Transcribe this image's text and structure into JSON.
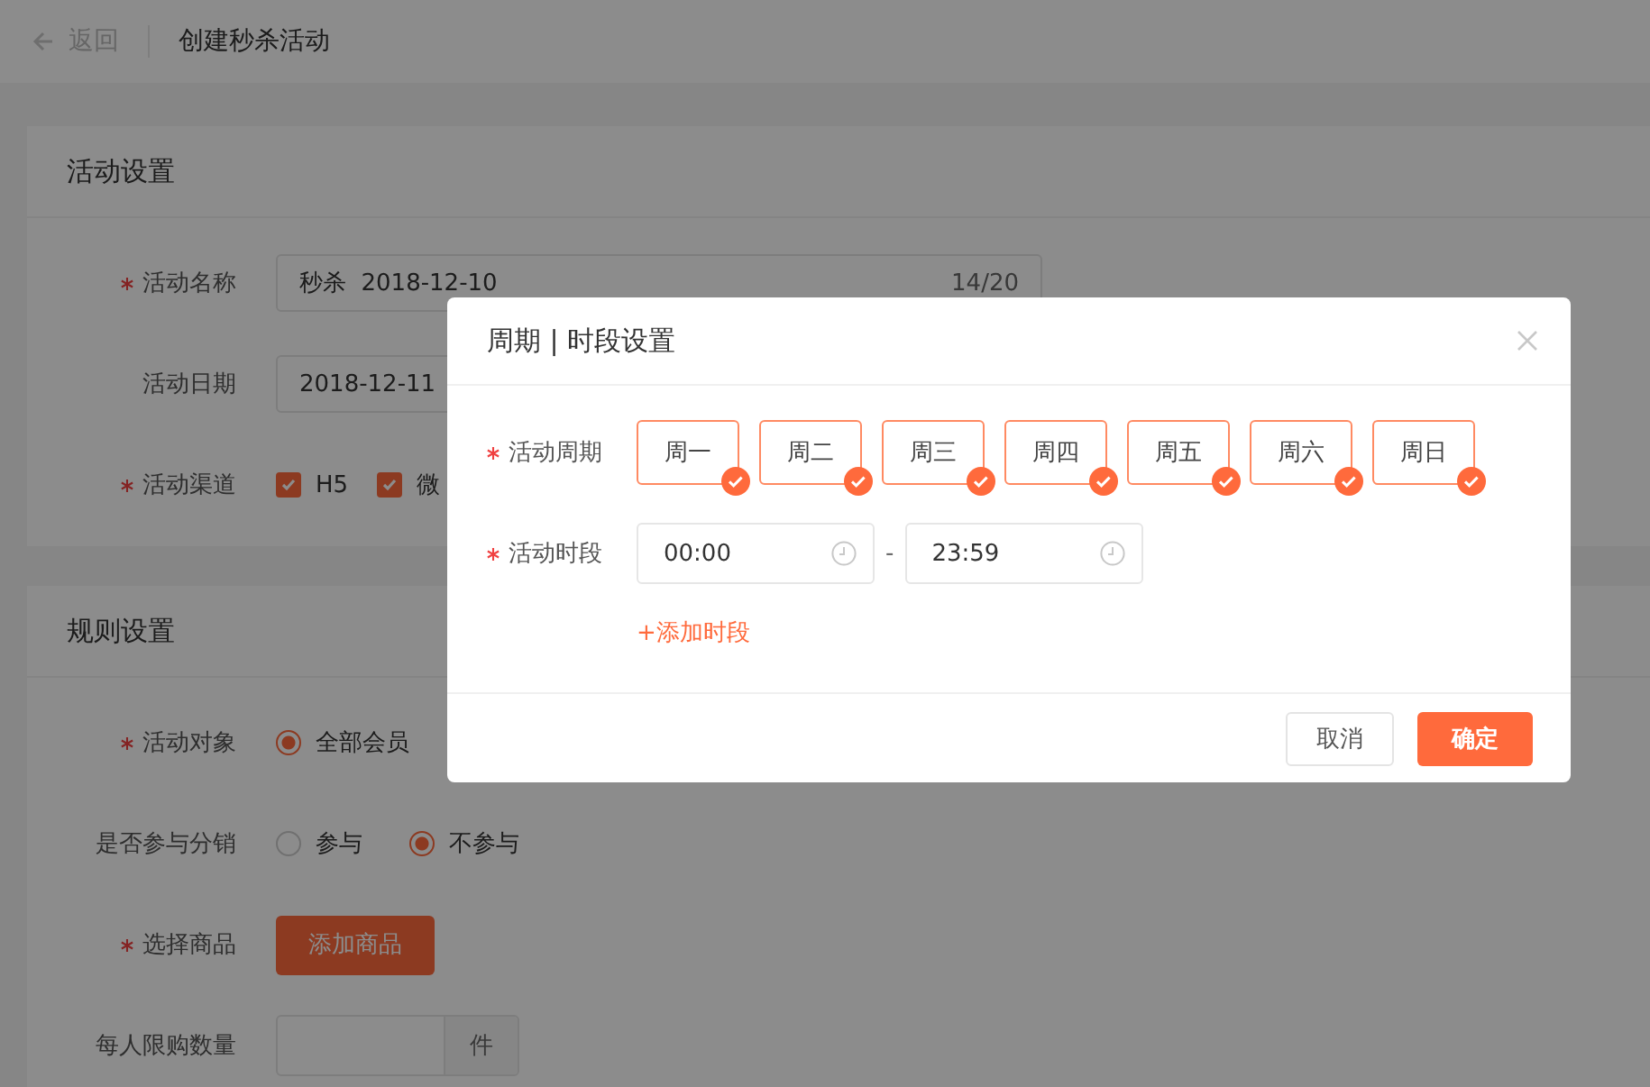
{
  "header": {
    "back": "返回",
    "title": "创建秒杀活动"
  },
  "sections": [
    {
      "title": "活动设置",
      "rows": [
        {
          "kind": "input",
          "label": "活动名称",
          "required": true,
          "value": "秒杀  2018-12-10",
          "counter": "14/20"
        },
        {
          "kind": "input",
          "label": "活动日期",
          "required": false,
          "value": "2018-12-11"
        },
        {
          "kind": "checkboxes",
          "label": "活动渠道",
          "required": true,
          "options": [
            {
              "label": "H5",
              "checked": true
            },
            {
              "label": "微",
              "checked": true
            }
          ]
        }
      ]
    },
    {
      "title": "规则设置",
      "rows": [
        {
          "kind": "radios",
          "label": "活动对象",
          "required": true,
          "options": [
            {
              "label": "全部会员",
              "selected": true
            }
          ]
        },
        {
          "kind": "radios",
          "label": "是否参与分销",
          "required": false,
          "options": [
            {
              "label": "参与",
              "selected": false
            },
            {
              "label": "不参与",
              "selected": true
            }
          ]
        },
        {
          "kind": "button",
          "label": "选择商品",
          "required": true,
          "button": "添加商品"
        },
        {
          "kind": "addon",
          "label": "每人限购数量",
          "required": false,
          "addon": "件"
        }
      ]
    }
  ],
  "dialog": {
    "title": "周期 | 时段设置",
    "days": {
      "label": "活动周期",
      "required": true,
      "items": [
        {
          "label": "周一",
          "checked": true
        },
        {
          "label": "周二",
          "checked": true
        },
        {
          "label": "周三",
          "checked": true
        },
        {
          "label": "周四",
          "checked": true
        },
        {
          "label": "周五",
          "checked": true
        },
        {
          "label": "周六",
          "checked": true
        },
        {
          "label": "周日",
          "checked": true
        }
      ]
    },
    "time": {
      "label": "活动时段",
      "required": true,
      "start": "00:00",
      "separator": "-",
      "end": "23:59"
    },
    "add_link": "+添加时段",
    "buttons": {
      "cancel": "取消",
      "confirm": "确定"
    }
  }
}
